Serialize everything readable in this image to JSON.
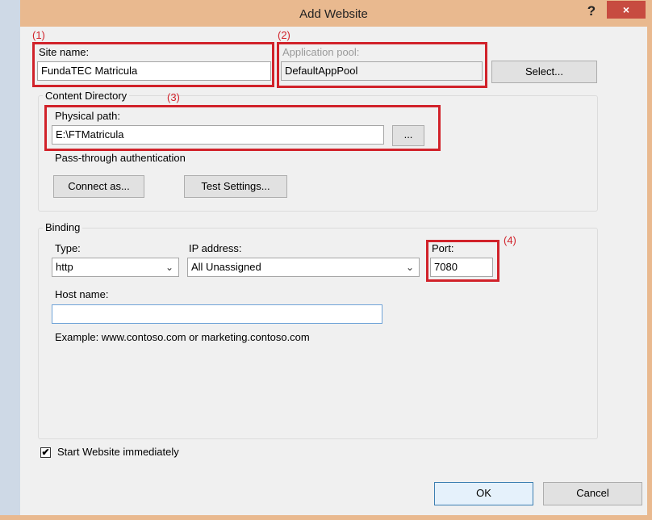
{
  "window": {
    "title": "Add Website",
    "help": "?",
    "close": "×"
  },
  "markers": {
    "m1": "(1)",
    "m2": "(2)",
    "m3": "(3)",
    "m4": "(4)"
  },
  "site_name": {
    "label": "Site name:",
    "value": "FundaTEC Matricula"
  },
  "app_pool": {
    "label": "Application pool:",
    "value": "DefaultAppPool",
    "select_button": "Select..."
  },
  "content_directory": {
    "legend": "Content Directory",
    "physical_path_label": "Physical path:",
    "physical_path_value": "E:\\FTMatricula",
    "browse_button": "...",
    "passthrough_label": "Pass-through authentication",
    "connect_button": "Connect as...",
    "test_button": "Test Settings..."
  },
  "binding": {
    "legend": "Binding",
    "type_label": "Type:",
    "type_value": "http",
    "ip_label": "IP address:",
    "ip_value": "All Unassigned",
    "port_label": "Port:",
    "port_value": "7080",
    "host_label": "Host name:",
    "host_value": "",
    "example": "Example: www.contoso.com or marketing.contoso.com"
  },
  "start_immediately": {
    "label": "Start Website immediately",
    "checked": true,
    "checkmark": "✔"
  },
  "footer": {
    "ok": "OK",
    "cancel": "Cancel"
  }
}
